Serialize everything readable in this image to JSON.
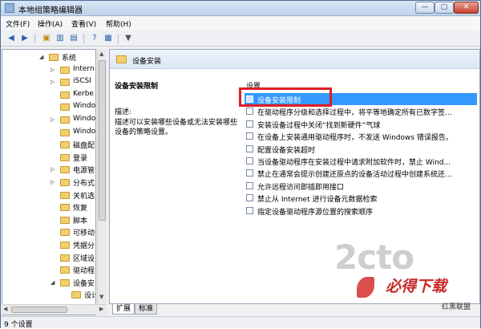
{
  "window": {
    "title": "本地组策略编辑器",
    "controls": {
      "minimize": "—",
      "maximize": "▢",
      "close": "✕"
    }
  },
  "menu": [
    "文件(F)",
    "操作(A)",
    "查看(V)",
    "帮助(H)"
  ],
  "tree": {
    "items": [
      {
        "label": "系统",
        "depth": 0,
        "expander": "◢"
      },
      {
        "label": "Intern",
        "depth": 1,
        "expander": "▷"
      },
      {
        "label": "iSCSI",
        "depth": 1,
        "expander": "▷"
      },
      {
        "label": "Kerbe",
        "depth": 1,
        "expander": ""
      },
      {
        "label": "Windo",
        "depth": 1,
        "expander": ""
      },
      {
        "label": "Windo",
        "depth": 1,
        "expander": "▷"
      },
      {
        "label": "Windo",
        "depth": 1,
        "expander": ""
      },
      {
        "label": "磁盘配",
        "depth": 1,
        "expander": ""
      },
      {
        "label": "登录",
        "depth": 1,
        "expander": ""
      },
      {
        "label": "电源管",
        "depth": 1,
        "expander": "▷"
      },
      {
        "label": "分布式",
        "depth": 1,
        "expander": "▷"
      },
      {
        "label": "关机选",
        "depth": 1,
        "expander": ""
      },
      {
        "label": "恢复",
        "depth": 1,
        "expander": ""
      },
      {
        "label": "脚本",
        "depth": 1,
        "expander": ""
      },
      {
        "label": "可移动",
        "depth": 1,
        "expander": ""
      },
      {
        "label": "凭据分",
        "depth": 1,
        "expander": ""
      },
      {
        "label": "区域设",
        "depth": 1,
        "expander": ""
      },
      {
        "label": "驱动程",
        "depth": 1,
        "expander": ""
      },
      {
        "label": "设备安",
        "depth": 1,
        "expander": "◢"
      },
      {
        "label": "设计",
        "depth": 2,
        "expander": ""
      }
    ]
  },
  "right": {
    "header": "设备安装",
    "desc_title": "设备安装限制",
    "desc_label": "描述:",
    "desc_text": "描述可以安装哪些设备或无法安装哪些设备的策略设置。",
    "list_header": "设置",
    "policies": [
      "设备安装限制",
      "在驱动程序分级和选择过程中，将平等地确定所有已数字签...",
      "安装设备过程中关闭“找到新硬件”气球",
      "在设备上安装通用驱动程序时，不发送 Windows 错误报告。",
      "配置设备安装超时",
      "当设备驱动程序在安装过程中请求附加软件时，禁止 Wind...",
      "禁止在通常会提示创建还原点的设备活动过程中创建系统还...",
      "允许远程访问即插即用接口",
      "禁止从 Internet 进行设备元数据检索",
      "指定设备驱动程序源位置的搜索顺序"
    ],
    "selected_index": 0
  },
  "tabs": [
    "扩展",
    "标准"
  ],
  "status": "9 个设置",
  "watermark": {
    "brand": "必得下载",
    "sub": "红黑联盟",
    "site": "2cto"
  }
}
